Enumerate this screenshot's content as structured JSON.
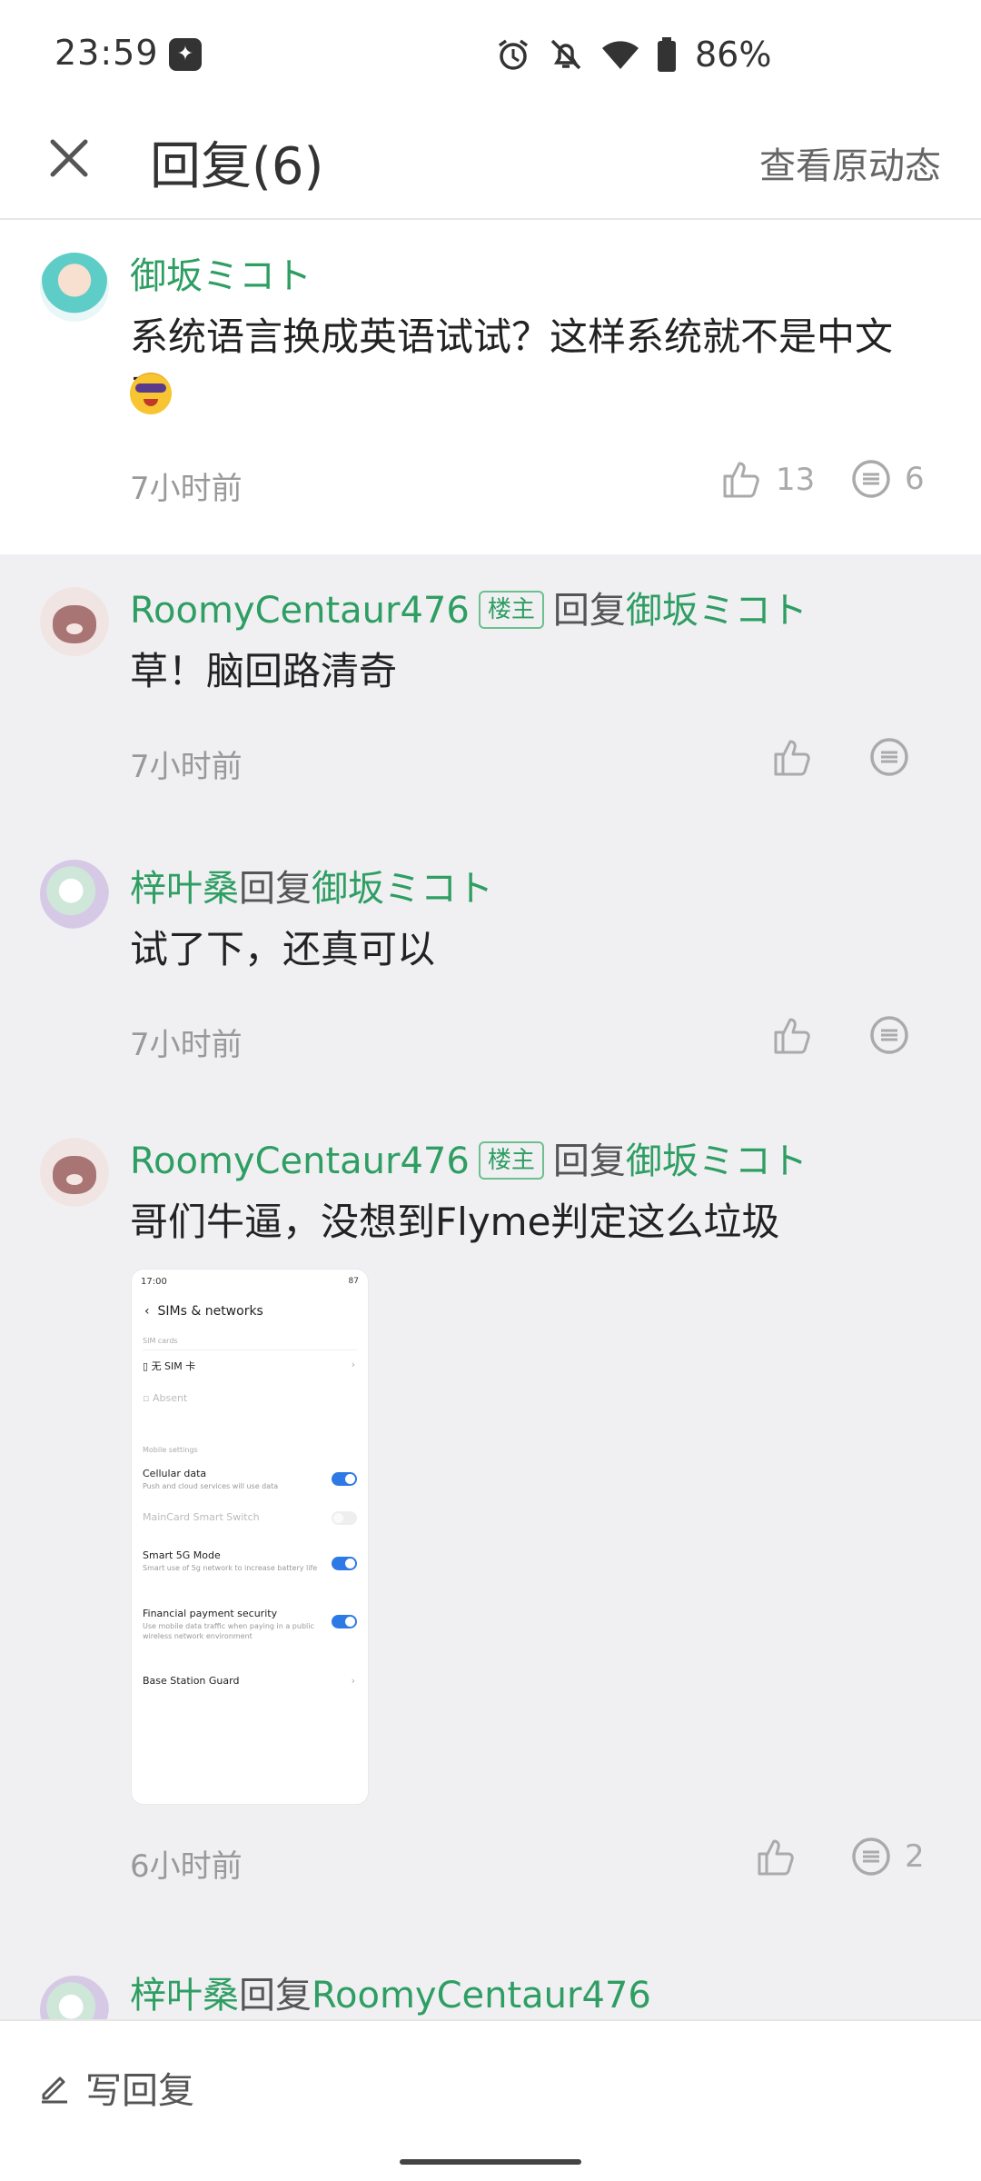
{
  "status_bar": {
    "time": "23:59",
    "battery": "86%"
  },
  "header": {
    "title": "回复(6)",
    "view_original": "查看原动态"
  },
  "top_comment": {
    "author": "御坂ミコト",
    "text": "系统语言换成英语试试？这样系统就不是中文了",
    "time": "7小时前",
    "likes": "13",
    "replies": "6"
  },
  "replies": [
    {
      "author": "RoomyCentaur476",
      "badge": "楼主",
      "reply_word": "回复",
      "reply_to": "御坂ミコト",
      "text": "草！脑回路清奇",
      "time": "7小时前"
    },
    {
      "author": "梓叶桑",
      "reply_word": "回复",
      "reply_to": "御坂ミコト",
      "text": "试了下，还真可以",
      "time": "7小时前"
    },
    {
      "author": "RoomyCentaur476",
      "badge": "楼主",
      "reply_word": "回复",
      "reply_to": "御坂ミコト",
      "text": "哥们牛逼，没想到Flyme判定这么垃圾",
      "time": "6小时前",
      "replies": "2",
      "image": {
        "status_time": "17:00",
        "status_right": "87",
        "title": "SIMs & networks",
        "sim_cards": "SIM cards",
        "no_sim": "无 SIM 卡",
        "absent": "Absent",
        "mobile_settings": "Mobile settings",
        "cellular_data": "Cellular data",
        "cellular_desc": "Push and cloud services will use data",
        "maincard": "MainCard Smart Switch",
        "smart5g": "Smart 5G Mode",
        "smart5g_desc": "Smart use of 5g network to increase battery life",
        "payment": "Financial payment security",
        "payment_desc": "Use mobile data traffic when paying in a public wireless network environment",
        "base_station": "Base Station Guard"
      }
    },
    {
      "author": "梓叶桑",
      "reply_word": "回复",
      "reply_to": "RoomyCentaur476"
    }
  ],
  "bottom_bar": {
    "write_reply": "写回复"
  }
}
